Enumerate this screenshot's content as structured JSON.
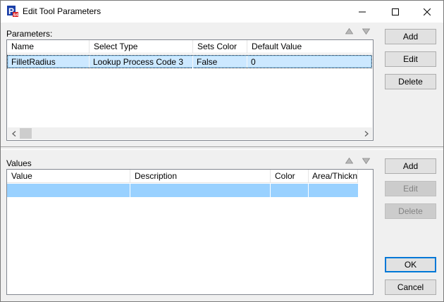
{
  "window": {
    "title": "Edit Tool Parameters",
    "icon": "app-logo-icon",
    "controls": [
      "minimize-icon",
      "maximize-icon",
      "close-icon"
    ]
  },
  "parameters": {
    "label": "Parameters:",
    "columns": [
      "Name",
      "Select Type",
      "Sets Color",
      "Default Value"
    ],
    "rows": [
      {
        "name": "FilletRadius",
        "select_type": "Lookup Process Code 3",
        "sets_color": "False",
        "default_value": "0",
        "selected": true
      }
    ],
    "buttons": {
      "add": "Add",
      "edit": "Edit",
      "delete": "Delete"
    }
  },
  "values": {
    "label": "Values",
    "columns": [
      "Value",
      "Description",
      "Color",
      "Area/Thickness"
    ],
    "rows": [
      {
        "value": "",
        "description": "",
        "color": "",
        "area_thickness": "",
        "selected": true
      }
    ],
    "buttons": {
      "add": "Add",
      "edit": "Edit",
      "delete": "Delete"
    }
  },
  "dialog_buttons": {
    "ok": "OK",
    "cancel": "Cancel"
  },
  "colors": {
    "selection": "#cce8ff",
    "selection_border": "#99d1ff",
    "empty_row": "#99d1ff",
    "accent": "#0078d7"
  }
}
